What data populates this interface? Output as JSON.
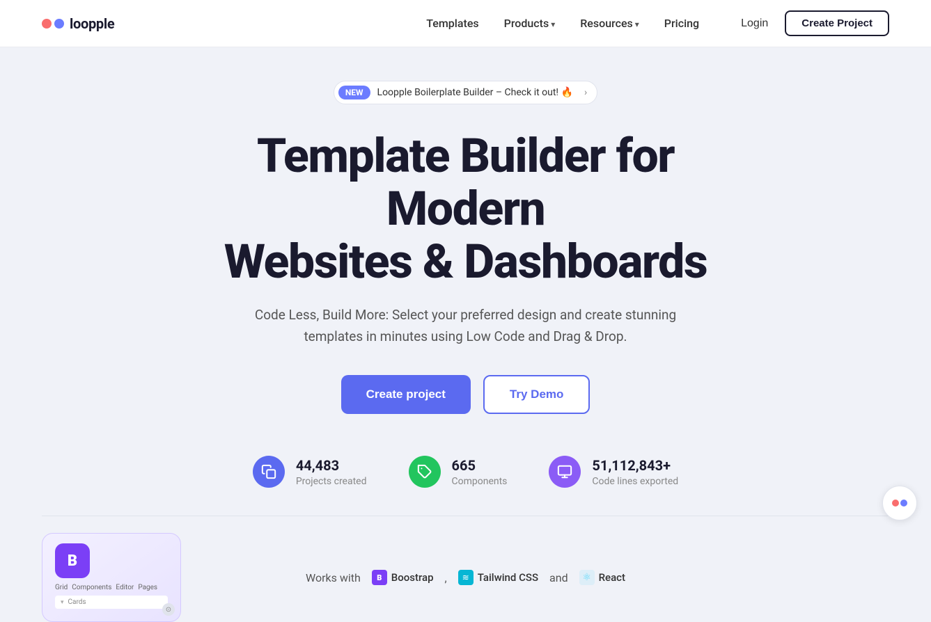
{
  "logo": {
    "text": "loopple"
  },
  "nav": {
    "links": [
      {
        "label": "Templates",
        "hasArrow": false
      },
      {
        "label": "Products",
        "hasArrow": true
      },
      {
        "label": "Resources",
        "hasArrow": true
      },
      {
        "label": "Pricing",
        "hasArrow": false
      }
    ],
    "login_label": "Login",
    "create_project_label": "Create Project"
  },
  "announcement": {
    "badge": "NEW",
    "text": "Loopple Boilerplate Builder – Check it out! 🔥"
  },
  "hero": {
    "heading_line1": "Template Builder for Modern",
    "heading_line2": "Websites & Dashboards",
    "subtext": "Code Less, Build More: Select your preferred design and create stunning templates in minutes using Low Code and Drag & Drop."
  },
  "cta": {
    "create_label": "Create project",
    "demo_label": "Try Demo"
  },
  "stats": [
    {
      "number": "44,483",
      "label": "Projects created",
      "icon": "copy-icon",
      "color": "blue"
    },
    {
      "number": "665",
      "label": "Components",
      "icon": "puzzle-icon",
      "color": "green"
    },
    {
      "number": "51,112,843+",
      "label": "Code lines exported",
      "icon": "monitor-icon",
      "color": "purple"
    }
  ],
  "works_with": {
    "prefix": "Works with",
    "frameworks": [
      {
        "name": "Boostrap",
        "color": "#7b3ff6"
      },
      {
        "name": "Tailwind CSS",
        "color": "#06b6d4"
      },
      {
        "name": "React",
        "color": "#61dafb"
      }
    ],
    "separator": "and"
  },
  "preview_card": {
    "tabs": [
      "Grid",
      "Components",
      "Editor",
      "Pages"
    ],
    "items": [
      "▾ Cards"
    ]
  }
}
